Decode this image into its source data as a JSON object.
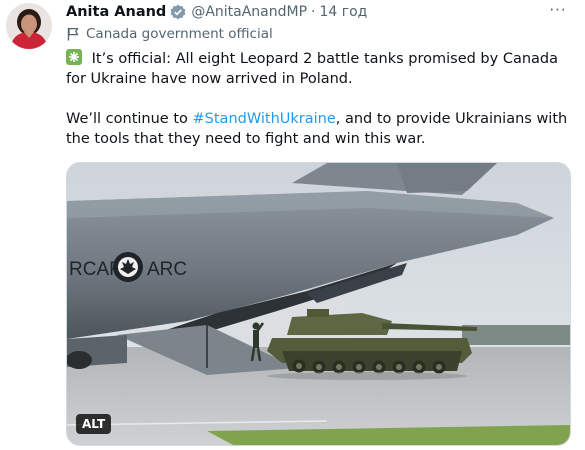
{
  "tweet": {
    "author_name": "Anita Anand",
    "handle": "@AnitaAnandMP",
    "separator": "·",
    "time": "14 год",
    "label": "Canada government official",
    "para1_rest": " It’s official: All eight Leopard 2 battle tanks promised by Canada for Ukraine have now arrived in Poland.",
    "para2_a": "We’ll continue to ",
    "hashtag": "#StandWithUkraine",
    "para2_b": ", and to provide Ukrainians with the tools that they need to fight and win this war.",
    "more_label": "···",
    "media": {
      "alt_badge": "ALT",
      "aircraft_text_left": "RCAF",
      "aircraft_text_right": "ARC"
    }
  },
  "icons": {
    "verified": "verified-badge-icon",
    "flag": "flag-icon",
    "check": "check-mark-emoji-icon",
    "more": "more-options-icon"
  },
  "colors": {
    "link": "#1d9bf0",
    "secondary": "#536471",
    "check_green": "#77b255",
    "verified_grey": "#829aab"
  }
}
